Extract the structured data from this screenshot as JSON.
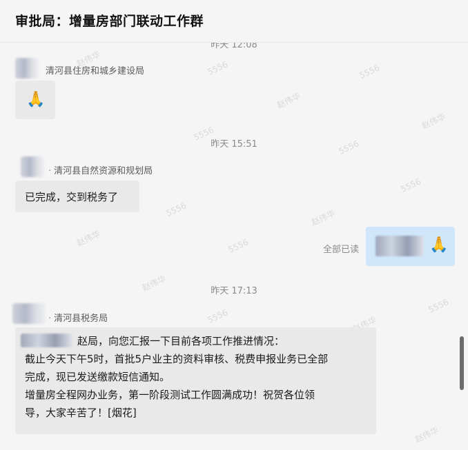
{
  "header": {
    "title": "审批局：增量房部门联动工作群"
  },
  "messages": {
    "m1": {
      "time": "昨天 12:08",
      "sender": "清河县住房和城乡建设局",
      "content_icon": "folded-hands-emoji"
    },
    "m2": {
      "time": "昨天 15:51",
      "sender": "清河县自然资源和规划局",
      "text": "已完成，交到税务了"
    },
    "m3": {
      "read_status": "全部已读",
      "content_icon": "folded-hands-emoji"
    },
    "m4": {
      "time": "昨天 17:13",
      "sender": "清河县税务局",
      "line1": "赵局，向您汇报一下目前各项工作推进情况：",
      "line2": "截止今天下午5时，首批5户业主的资料审核、税费申报业务已全部",
      "line3": "完成，现已发送缴款短信通知。",
      "line4": "增量房全程网办业务，第一阶段测试工作圆满成功！祝贺各位领",
      "line5": "导，大家辛苦了！[烟花]"
    }
  },
  "watermark": {
    "texts": [
      "5556",
      "赵伟华"
    ]
  },
  "colors": {
    "background": "#f5f5f5",
    "bubble_other": "#e9e9e9",
    "bubble_self": "#cfe6fb",
    "scrollbar": "#6b6b6b"
  }
}
